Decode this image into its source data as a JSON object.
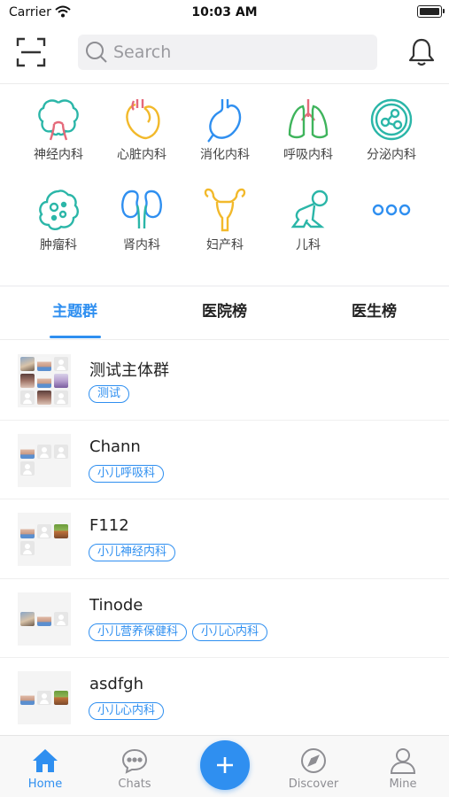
{
  "status_bar": {
    "carrier": "Carrier",
    "time": "10:03 AM"
  },
  "header": {
    "search_placeholder": "Search"
  },
  "colors": {
    "accent": "#2f8ff0",
    "teal": "#2bb6a8",
    "yellow": "#f2b92b",
    "pink": "#e5697a",
    "green": "#3fb45c"
  },
  "categories": [
    {
      "label": "神经内科",
      "icon": "brain-icon"
    },
    {
      "label": "心脏内科",
      "icon": "heart-icon"
    },
    {
      "label": "消化内科",
      "icon": "stomach-icon"
    },
    {
      "label": "呼吸内科",
      "icon": "lungs-icon"
    },
    {
      "label": "分泌内科",
      "icon": "endocrine-icon"
    },
    {
      "label": "肿瘤科",
      "icon": "tumor-icon"
    },
    {
      "label": "肾内科",
      "icon": "kidney-icon"
    },
    {
      "label": "妇产科",
      "icon": "uterus-icon"
    },
    {
      "label": "儿科",
      "icon": "baby-icon"
    },
    {
      "label": "",
      "icon": "more-icon"
    }
  ],
  "tabs": [
    {
      "label": "主题群",
      "active": true
    },
    {
      "label": "医院榜",
      "active": false
    },
    {
      "label": "医生榜",
      "active": false
    }
  ],
  "groups": [
    {
      "name": "测试主体群",
      "tags": [
        "测试"
      ]
    },
    {
      "name": "Chann",
      "tags": [
        "小儿呼吸科"
      ]
    },
    {
      "name": "F112",
      "tags": [
        "小儿神经内科"
      ]
    },
    {
      "name": "Tinode",
      "tags": [
        "小儿营养保健科",
        "小儿心内科"
      ]
    },
    {
      "name": "asdfgh",
      "tags": [
        "小儿心内科"
      ]
    }
  ],
  "bottom_nav": {
    "home": "Home",
    "chats": "Chats",
    "discover": "Discover",
    "mine": "Mine"
  }
}
